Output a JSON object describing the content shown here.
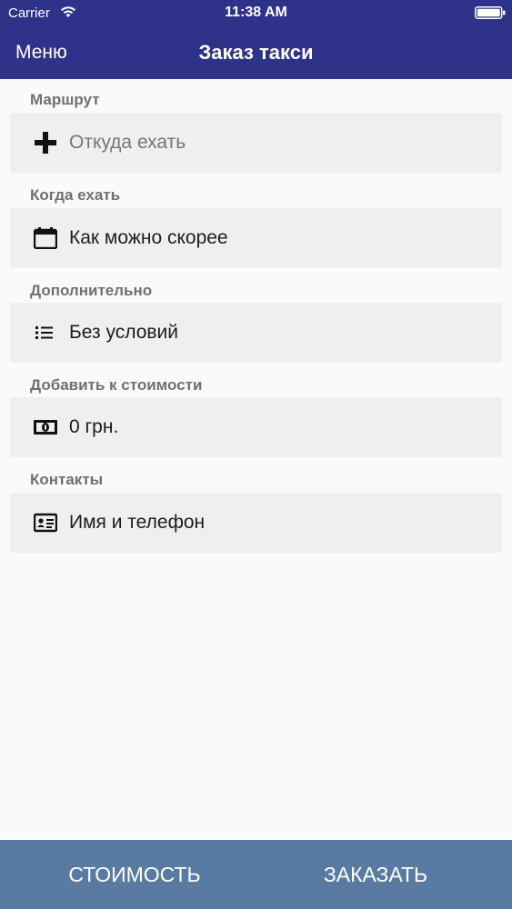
{
  "status_bar": {
    "carrier": "Carrier",
    "time": "11:38 AM"
  },
  "nav": {
    "menu_label": "Меню",
    "title": "Заказ такси"
  },
  "sections": [
    {
      "label": "Маршрут",
      "field_text": "Откуда ехать",
      "icon": "plus-icon",
      "is_placeholder": true
    },
    {
      "label": "Когда ехать",
      "field_text": "Как можно скорее",
      "icon": "calendar-icon",
      "is_placeholder": false
    },
    {
      "label": "Дополнительно",
      "field_text": "Без условий",
      "icon": "list-icon",
      "is_placeholder": false
    },
    {
      "label": "Добавить к стоимости",
      "field_text": "0 грн.",
      "icon": "money-icon",
      "is_placeholder": false
    },
    {
      "label": "Контакты",
      "field_text": "Имя и телефон",
      "icon": "contact-card-icon",
      "is_placeholder": false
    }
  ],
  "bottom_bar": {
    "cost_label": "СТОИМОСТЬ",
    "order_label": "ЗАКАЗАТЬ"
  },
  "colors": {
    "nav_background": "#2e3288",
    "bottom_bar_background": "#5a7ba1",
    "field_background": "#efeef0"
  }
}
